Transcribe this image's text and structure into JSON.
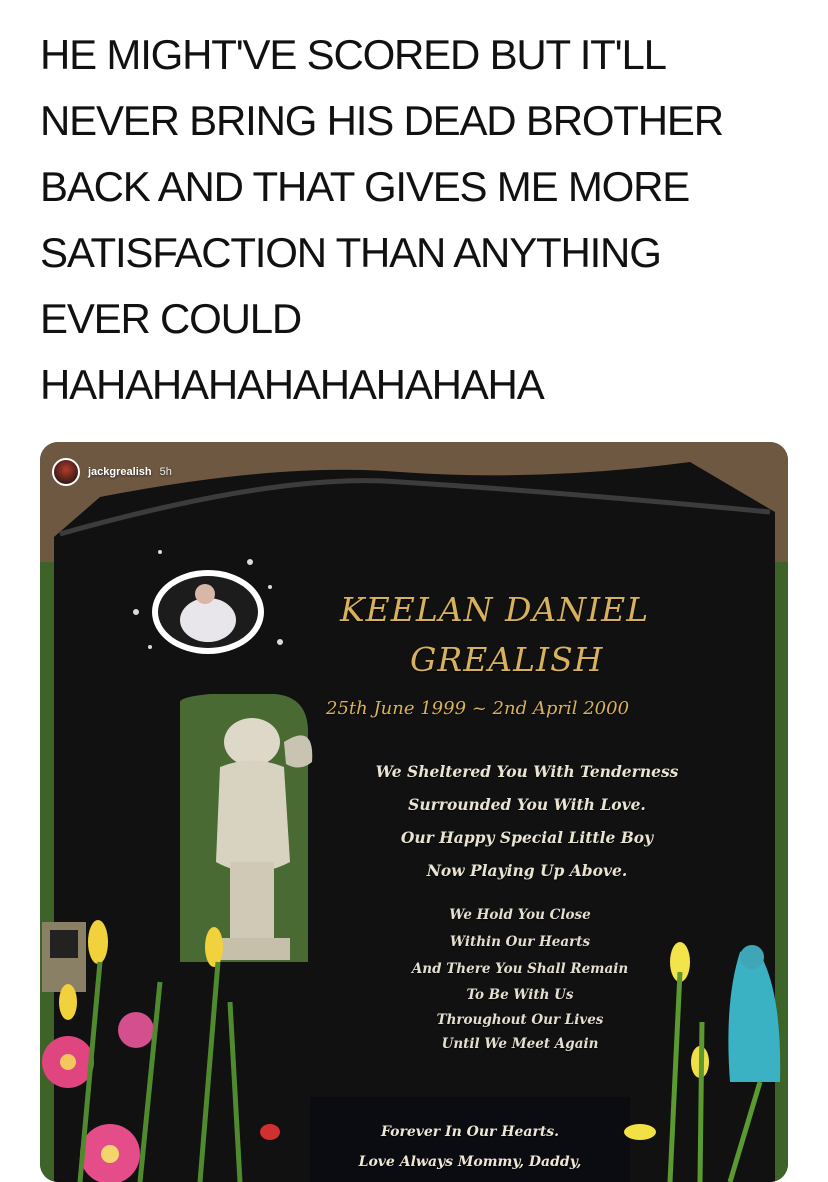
{
  "caption": {
    "lines": [
      "HE MIGHT'VE SCORED BUT IT'LL",
      "NEVER BRING HIS DEAD BROTHER",
      "BACK AND THAT GIVES ME MORE",
      "SATISFACTION THAN ANYTHING",
      "EVER COULD",
      "HAHAHAHAHAHAHAHAHA"
    ]
  },
  "story": {
    "username": "jackgrealish",
    "time": "5h"
  },
  "headstone": {
    "name_line1": "KEELAN DANIEL",
    "name_line2": "GREALISH",
    "dates": "25th June 1999 ~ 2nd April 2000",
    "verse1": [
      "We Sheltered You With Tenderness",
      "Surrounded You With Love.",
      "Our Happy Special Little Boy",
      "Now Playing Up Above."
    ],
    "verse2": [
      "We Hold You Close",
      "Within Our Hearts",
      "And There You Shall Remain",
      "To Be With Us",
      "Throughout Our Lives",
      "Until We Meet Again"
    ],
    "plaque": [
      "Forever In Our Hearts.",
      "Love Always Mommy, Daddy,"
    ]
  },
  "colors": {
    "granite": "#141414",
    "gold_lettering": "#d8b15c",
    "grass": "#3f6a2c"
  }
}
